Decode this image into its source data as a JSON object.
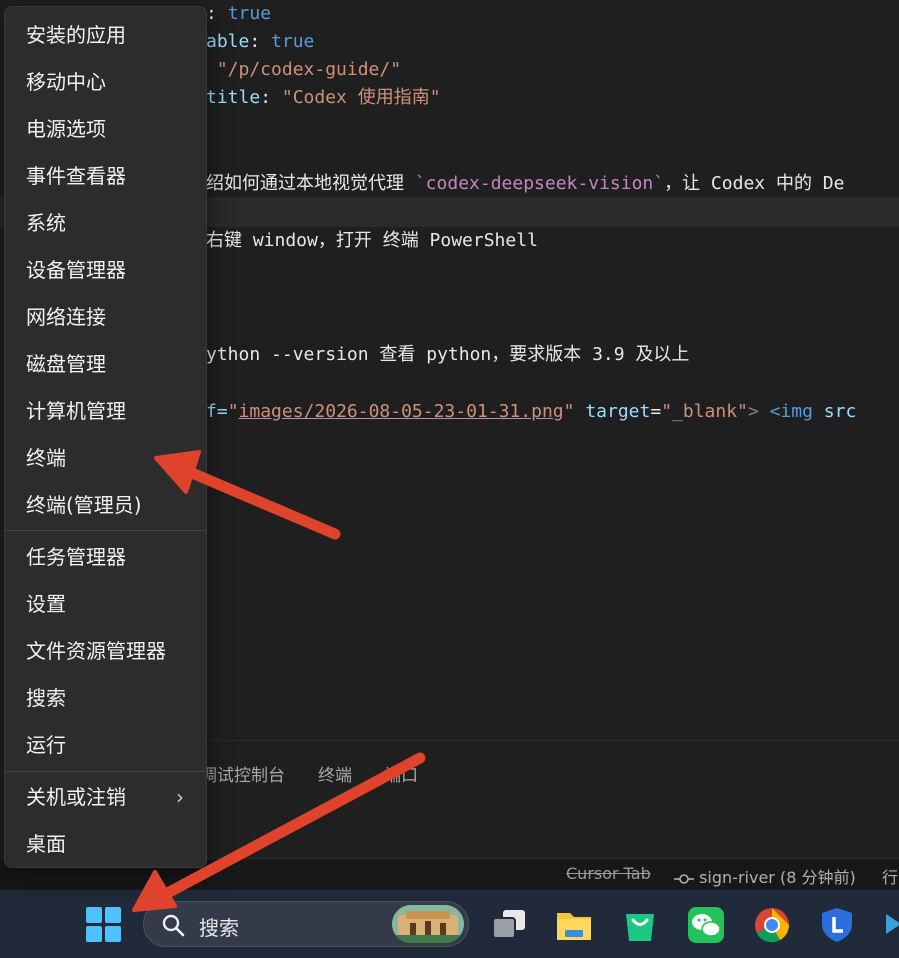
{
  "editor": {
    "lines": [
      [
        {
          "t": ": ",
          "c": "w"
        },
        {
          "t": "true",
          "c": "b"
        }
      ],
      [
        {
          "t": "able",
          "c": "k"
        },
        {
          "t": ": ",
          "c": "w"
        },
        {
          "t": "true",
          "c": "b"
        }
      ],
      [
        {
          "t": " \"/p/codex-guide/\"",
          "c": "s"
        }
      ],
      [
        {
          "t": "title",
          "c": "k"
        },
        {
          "t": ": ",
          "c": "w"
        },
        {
          "t": "\"Codex 使用指南\"",
          "c": "s"
        }
      ],
      [
        {
          "t": "绍如何通过本地视觉代理 ",
          "c": "w"
        },
        {
          "t": "`codex-deepseek-vision`",
          "c": "p"
        },
        {
          "t": "，让 Codex 中的 De",
          "c": "w"
        }
      ],
      [
        {
          "t": "右键 window，打开 终端 PowerShell",
          "c": "w"
        }
      ],
      [
        {
          "t": "ython --version 查看 python，要求版本 3.9 及以上",
          "c": "w"
        }
      ],
      [
        {
          "t": "f=",
          "c": "k"
        },
        {
          "t": "\"",
          "c": "s"
        },
        {
          "t": "images/2026-08-05-23-01-31.png",
          "c": "s u"
        },
        {
          "t": "\"",
          "c": "s"
        },
        {
          "t": " ",
          "c": "w"
        },
        {
          "t": "target",
          "c": "k"
        },
        {
          "t": "=",
          "c": "w"
        },
        {
          "t": "\"_blank\"",
          "c": "s"
        },
        {
          "t": "> ",
          "c": "q"
        },
        {
          "t": "<img ",
          "c": "b"
        },
        {
          "t": "src",
          "c": "k"
        }
      ]
    ]
  },
  "panel": {
    "tabs": [
      "调试控制台",
      "终端",
      "端口"
    ]
  },
  "statusbar": {
    "cursor_tab": "Cursor Tab",
    "git": "sign-river (8 分钟前)",
    "extra": "行"
  },
  "menu": {
    "groups": [
      [
        "安装的应用",
        "移动中心",
        "电源选项",
        "事件查看器",
        "系统",
        "设备管理器",
        "网络连接",
        "磁盘管理",
        "计算机管理",
        "终端",
        "终端(管理员)"
      ],
      [
        "任务管理器",
        "设置",
        "文件资源管理器",
        "搜索",
        "运行"
      ],
      [
        "关机或注销",
        "桌面"
      ]
    ],
    "submenu_indicator": "›"
  },
  "taskbar": {
    "search_label": "搜索",
    "apps": [
      "task-view-icon",
      "file-explorer-icon",
      "shopping-bag-icon",
      "wechat-icon",
      "chrome-icon",
      "security-shield-icon"
    ]
  },
  "colors": {
    "accent": "#4cc2ff",
    "annotation_arrow": "#e0432c",
    "menu_bg": "#2c2c2c",
    "editor_bg": "#1f1f1f"
  }
}
